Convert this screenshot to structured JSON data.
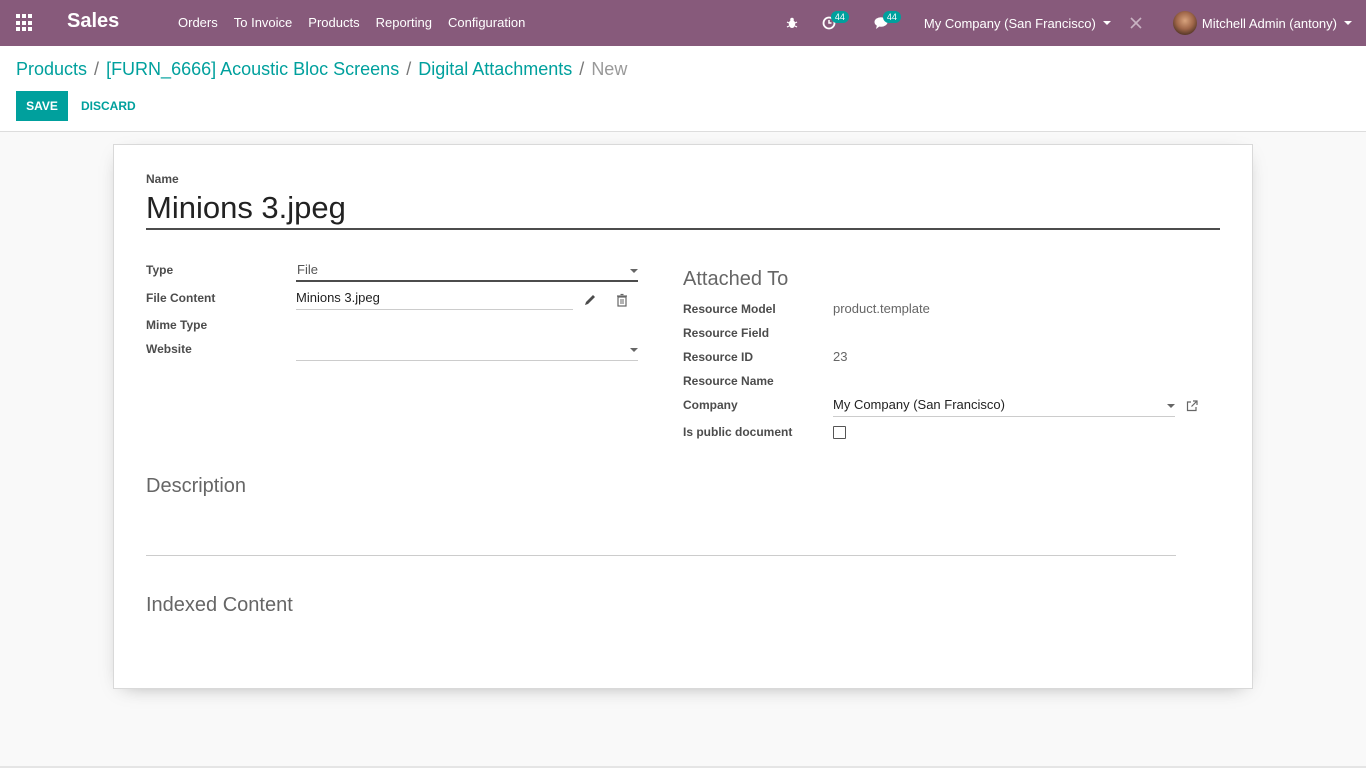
{
  "navbar": {
    "app_title": "Sales",
    "menu": [
      "Orders",
      "To Invoice",
      "Products",
      "Reporting",
      "Configuration"
    ],
    "activity_count": "44",
    "message_count": "44",
    "company": "My Company (San Francisco)",
    "user": "Mitchell Admin (antony)",
    "bg_color": "#875a7b"
  },
  "breadcrumb": {
    "items": [
      "Products",
      "[FURN_6666] Acoustic Bloc Screens",
      "Digital Attachments"
    ],
    "current": "New"
  },
  "buttons": {
    "save": "SAVE",
    "discard": "DISCARD"
  },
  "form": {
    "name_label": "Name",
    "name_value": "Minions 3.jpeg",
    "type_label": "Type",
    "type_value": "File",
    "file_content_label": "File Content",
    "file_content_value": "Minions 3.jpeg",
    "mime_type_label": "Mime Type",
    "website_label": "Website",
    "website_value": "",
    "attached_to_title": "Attached To",
    "resource_model_label": "Resource Model",
    "resource_model_value": "product.template",
    "resource_field_label": "Resource Field",
    "resource_id_label": "Resource ID",
    "resource_id_value": "23",
    "resource_name_label": "Resource Name",
    "company_label": "Company",
    "company_value": "My Company (San Francisco)",
    "public_label": "Is public document",
    "is_public": false,
    "description_title": "Description",
    "indexed_title": "Indexed Content"
  },
  "accent_color": "#00a09d"
}
